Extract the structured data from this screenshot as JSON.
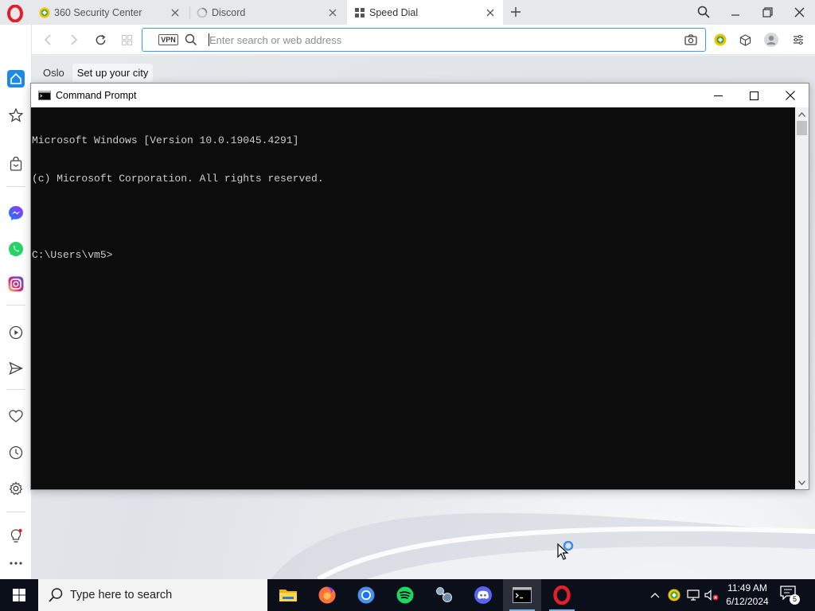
{
  "browser": {
    "tabs": [
      {
        "label": "360 Security Center",
        "icon": "360-security-icon",
        "active": false
      },
      {
        "label": "Discord",
        "icon": "loading-spinner-icon",
        "active": false
      },
      {
        "label": "Speed Dial",
        "icon": "speed-dial-grid-icon",
        "active": true
      }
    ],
    "address": {
      "vpn_label": "VPN",
      "placeholder": "Enter search or web address",
      "value": ""
    },
    "speed_dial": {
      "city": "Oslo",
      "setup_city": "Set up your city"
    },
    "sidebar_items": [
      "home-icon",
      "pinboard-icon",
      "shopping-icon",
      "messenger-icon",
      "whatsapp-icon",
      "instagram-icon",
      "player-icon",
      "send-icon",
      "heart-icon",
      "history-icon",
      "settings-icon",
      "tips-icon",
      "more-icon"
    ]
  },
  "cmd": {
    "title": "Command Prompt",
    "lines": [
      "Microsoft Windows [Version 10.0.19045.4291]",
      "(c) Microsoft Corporation. All rights reserved.",
      "",
      "C:\\Users\\vm5>"
    ]
  },
  "taskbar": {
    "search_placeholder": "Type here to search",
    "apps": [
      "file-explorer-icon",
      "firefox-icon",
      "chrome-icon",
      "spotify-icon",
      "network-app-icon",
      "discord-icon",
      "cmd-icon",
      "opera-icon"
    ],
    "time": "11:49 AM",
    "date": "6/12/2024",
    "notification_count": "5"
  },
  "colors": {
    "accent": "#3b9cf2",
    "opera_red": "#e3202a",
    "console_bg": "#0c0c0c",
    "console_text": "#cccccc",
    "taskbar_bg": "#0a0f1a"
  }
}
